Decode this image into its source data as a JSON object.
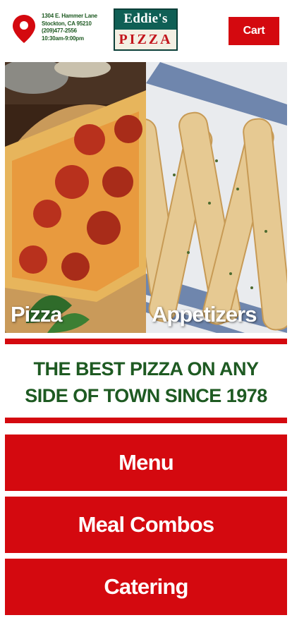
{
  "header": {
    "address_line1": "1304 E. Hammer Lane",
    "address_line2": "Stockton, CA 95210",
    "phone": "(209)477-2556",
    "hours": "10:30am-9:00pm",
    "logo_line1": "Eddie's",
    "logo_line2": "PIZZA",
    "cart_label": "Cart"
  },
  "tiles": [
    {
      "label": "Pizza"
    },
    {
      "label": "Appetizers"
    }
  ],
  "tagline": "THE BEST PIZZA ON ANY SIDE OF TOWN SINCE 1978",
  "nav": {
    "menu_label": "Menu",
    "combos_label": "Meal Combos",
    "catering_label": "Catering"
  },
  "colors": {
    "brand_red": "#d4090f",
    "brand_green": "#1e5a22",
    "logo_teal": "#0f5f55"
  },
  "icons": [
    "map-pin-icon"
  ]
}
